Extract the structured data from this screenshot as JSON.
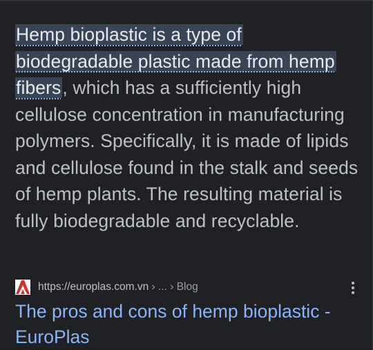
{
  "snippet": {
    "highlighted": "Hemp bioplastic is a type of biodegradable plastic made from hemp fibers",
    "rest": ", which has a sufficiently high cellulose concentration in manufacturing polymers. Specifically, it is made of lipids and cellulose found in the stalk and seeds of hemp plants. The resulting material is fully biodegradable and recyclable."
  },
  "source": {
    "favicon_icon": "europlas-logo",
    "favicon_color": "#d32f2f",
    "url": "https://europlas.com.vn",
    "breadcrumb": " › ... › Blog",
    "more_icon": "three-dots-vertical-icon"
  },
  "result": {
    "title": "The pros and cons of hemp bioplastic - EuroPlas"
  },
  "colors": {
    "background": "#202124",
    "text": "#bdc1c6",
    "highlight_bg": "#394457",
    "link": "#8ab4f8"
  }
}
